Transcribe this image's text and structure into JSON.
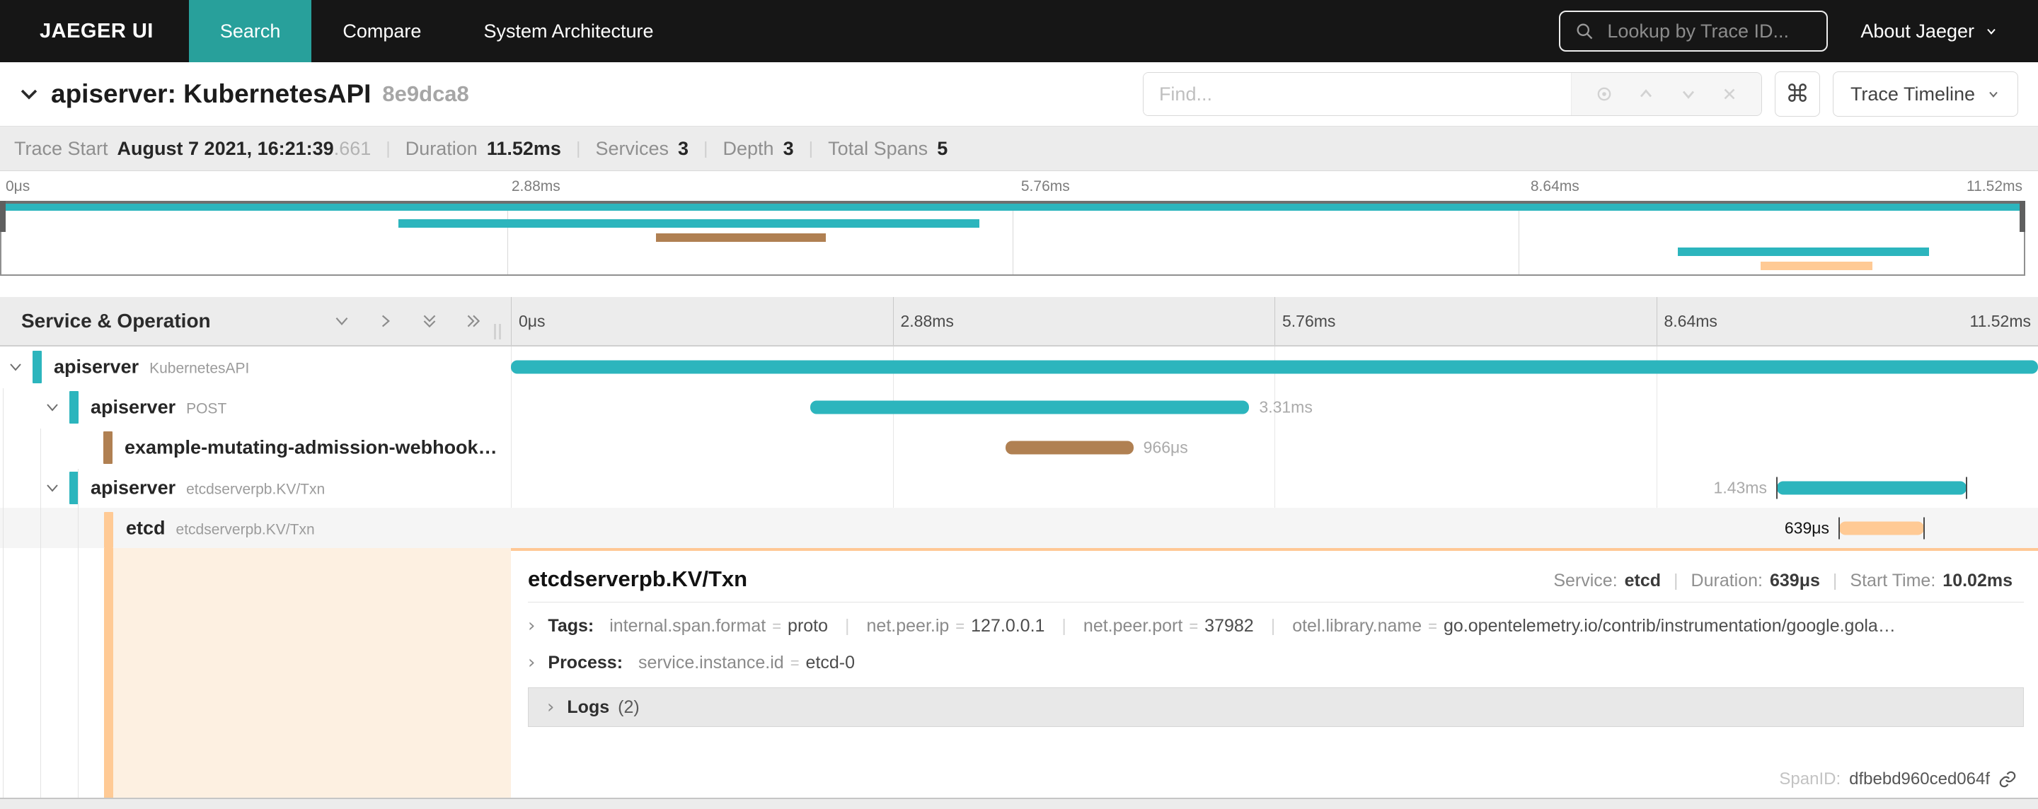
{
  "navbar": {
    "brand": "JAEGER UI",
    "items": [
      {
        "label": "Search"
      },
      {
        "label": "Compare"
      },
      {
        "label": "System Architecture"
      }
    ],
    "lookup_placeholder": "Lookup by Trace ID...",
    "about_label": "About Jaeger"
  },
  "trace_header": {
    "title": "apiserver: KubernetesAPI",
    "trace_id_short": "8e9dca8",
    "find_placeholder": "Find...",
    "view_select_label": "Trace Timeline"
  },
  "info_bar": {
    "trace_start_label": "Trace Start",
    "trace_start_value": "August 7 2021, 16:21:39",
    "trace_start_fraction": ".661",
    "duration_label": "Duration",
    "duration_value": "11.52ms",
    "services_label": "Services",
    "services_value": "3",
    "depth_label": "Depth",
    "depth_value": "3",
    "total_spans_label": "Total Spans",
    "total_spans_value": "5"
  },
  "timeline": {
    "total_ms": 11.52,
    "axis_ticks": [
      "0μs",
      "2.88ms",
      "5.76ms",
      "8.64ms",
      "11.52ms"
    ],
    "left_header": "Service & Operation",
    "colors": {
      "teal": "#2cb5bd",
      "brown": "#b08052",
      "peach": "#ffca95",
      "navbar_accent": "#28a09b"
    },
    "spans": [
      {
        "service": "apiserver",
        "operation": "KubernetesAPI",
        "color": "#2cb5bd",
        "start_ms": 0,
        "duration_ms": 11.52,
        "duration_label": "",
        "label_side": "none",
        "ticks": false,
        "selected": false
      },
      {
        "service": "apiserver",
        "operation": "POST",
        "color": "#2cb5bd",
        "start_ms": 2.26,
        "duration_ms": 3.31,
        "duration_label": "3.31ms",
        "label_side": "right",
        "ticks": false,
        "selected": false
      },
      {
        "service": "example-mutating-admission-webhook…",
        "operation": "",
        "color": "#b08052",
        "start_ms": 3.73,
        "duration_ms": 0.966,
        "duration_label": "966μs",
        "label_side": "right",
        "ticks": false,
        "selected": false
      },
      {
        "service": "apiserver",
        "operation": "etcdserverpb.KV/Txn",
        "color": "#2cb5bd",
        "start_ms": 9.55,
        "duration_ms": 1.43,
        "duration_label": "1.43ms",
        "label_side": "left",
        "ticks": true,
        "selected": false
      },
      {
        "service": "etcd",
        "operation": "etcdserverpb.KV/Txn",
        "color": "#ffca95",
        "start_ms": 10.02,
        "duration_ms": 0.639,
        "duration_label": "639μs",
        "label_side": "left",
        "ticks": true,
        "selected": true
      }
    ]
  },
  "detail": {
    "title": "etcdserverpb.KV/Txn",
    "service_label": "Service:",
    "service_value": "etcd",
    "duration_label": "Duration:",
    "duration_value": "639μs",
    "start_time_label": "Start Time:",
    "start_time_value": "10.02ms",
    "tags_label": "Tags:",
    "tags": [
      {
        "k": "internal.span.format",
        "v": "proto"
      },
      {
        "k": "net.peer.ip",
        "v": "127.0.0.1"
      },
      {
        "k": "net.peer.port",
        "v": "37982"
      },
      {
        "k": "otel.library.name",
        "v": "go.opentelemetry.io/contrib/instrumentation/google.gola…"
      }
    ],
    "process_label": "Process:",
    "process": [
      {
        "k": "service.instance.id",
        "v": "etcd-0"
      }
    ],
    "logs_label": "Logs",
    "logs_count": "(2)",
    "spanid_label": "SpanID:",
    "spanid_value": "dfbebd960ced064f"
  }
}
